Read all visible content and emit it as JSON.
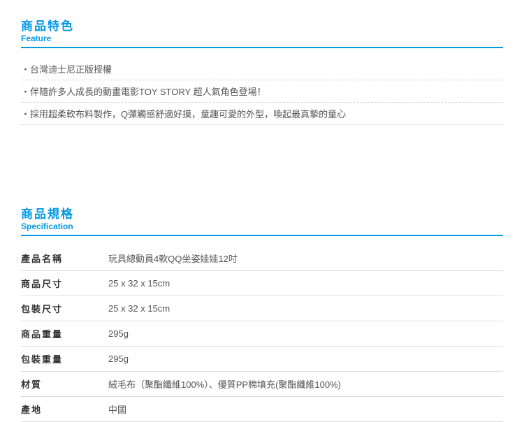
{
  "sections": {
    "feature": {
      "title_zh": "商品特色",
      "title_en": "Feature"
    },
    "spec": {
      "title_zh": "商品規格",
      "title_en": "Specification"
    }
  },
  "features": [
    "台灣迪士尼正版授權",
    "伴隨許多人成長的動畫電影TOY STORY 超人氣角色登場！",
    "採用超柔軟布料製作，Q彈觸感舒適好摸，童趣可愛的外型，喚起最真摯的童心"
  ],
  "spec_rows": [
    {
      "label": "產品名稱",
      "value": "玩具總動員4軟QQ坐姿娃娃12吋"
    },
    {
      "label": "商品尺寸",
      "value": "25 x 32 x 15cm"
    },
    {
      "label": "包裝尺寸",
      "value": "25 x 32 x 15cm"
    },
    {
      "label": "商品重量",
      "value": "295g"
    },
    {
      "label": "包裝重量",
      "value": "295g"
    },
    {
      "label": "材質",
      "value": "絨毛布（聚酯纖維100%）、優質PP棉填充(聚酯纖維100%)"
    },
    {
      "label": "產地",
      "value": "中國"
    }
  ]
}
